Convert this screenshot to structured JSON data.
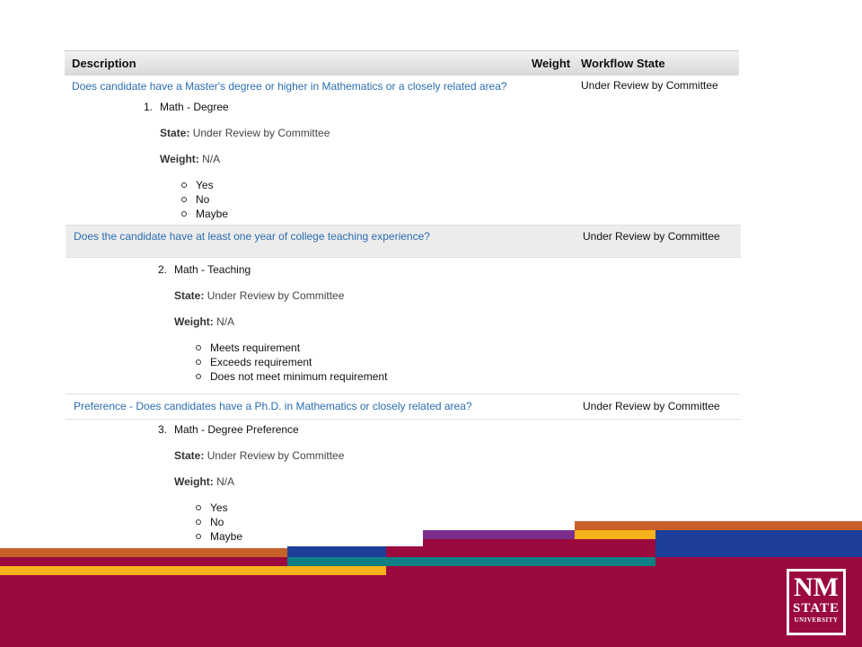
{
  "table": {
    "headers": {
      "description": "Description",
      "weight": "Weight",
      "workflow_state": "Workflow State"
    },
    "rows": [
      {
        "question": "Does candidate have a Master's degree or higher in Mathematics or a closely related area?",
        "workflow_state": "Under Review by Committee",
        "number": "1.",
        "title": "Math - Degree",
        "state_label": "State:",
        "state_value": "Under Review by Committee",
        "weight_label": "Weight:",
        "weight_value": "N/A",
        "options": [
          "Yes",
          "No",
          "Maybe"
        ]
      },
      {
        "question": "Does the candidate have at least one year of college teaching experience?",
        "workflow_state": "Under Review by Committee",
        "number": "2.",
        "title": "Math - Teaching",
        "state_label": "State:",
        "state_value": "Under Review by Committee",
        "weight_label": "Weight:",
        "weight_value": "N/A",
        "options": [
          "Meets requirement",
          "Exceeds requirement",
          "Does not meet minimum requirement"
        ]
      },
      {
        "question": "Preference - Does candidates have a Ph.D. in Mathematics or closely related area?",
        "workflow_state": "Under Review by Committee",
        "number": "3.",
        "title": "Math - Degree Preference",
        "state_label": "State:",
        "state_value": "Under Review by Committee",
        "weight_label": "Weight:",
        "weight_value": "N/A",
        "options": [
          "Yes",
          "No",
          "Maybe"
        ]
      }
    ]
  },
  "logo": {
    "line1": "NM",
    "line2": "STATE",
    "line3": "UNIVERSITY"
  },
  "colors": {
    "link": "#2a6db0",
    "crimson": "#9a0a3e",
    "orange": "#c8602a",
    "gold": "#f6b21a",
    "blue": "#1d3f9a",
    "teal": "#0f7f84",
    "purple": "#7a2d8f"
  }
}
